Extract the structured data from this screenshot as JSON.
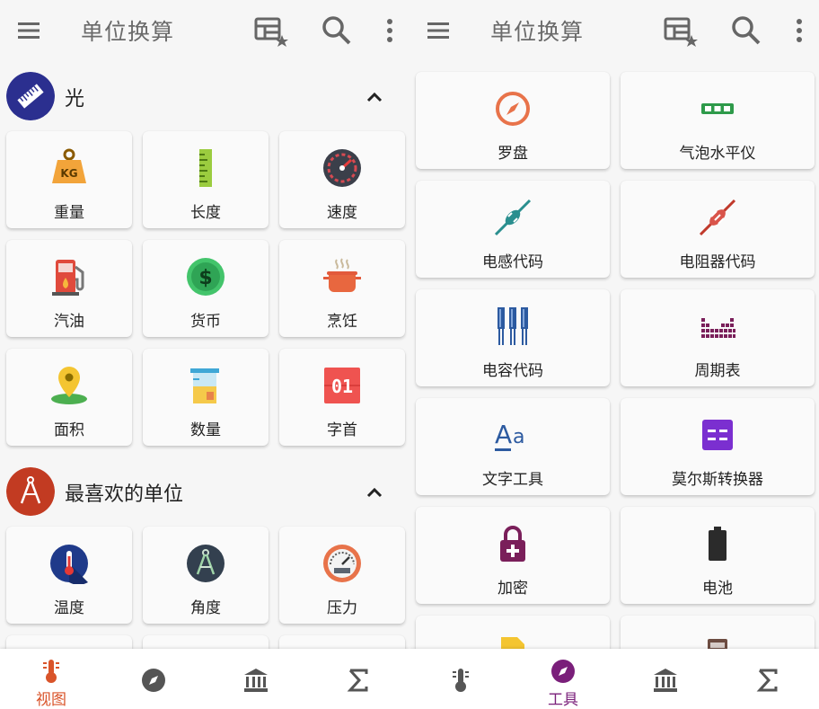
{
  "left": {
    "appbar": {
      "title": "单位换算"
    },
    "section_light": {
      "title": "光"
    },
    "light_tiles": [
      {
        "label": "重量",
        "icon": "weight-icon"
      },
      {
        "label": "长度",
        "icon": "ruler-icon"
      },
      {
        "label": "速度",
        "icon": "speedometer-icon"
      },
      {
        "label": "汽油",
        "icon": "fuel-pump-icon"
      },
      {
        "label": "货币",
        "icon": "currency-icon"
      },
      {
        "label": "烹饪",
        "icon": "cooking-pot-icon"
      },
      {
        "label": "面积",
        "icon": "map-pin-icon"
      },
      {
        "label": "数量",
        "icon": "beaker-icon"
      },
      {
        "label": "字首",
        "icon": "prefix-icon"
      }
    ],
    "section_fav": {
      "title": "最喜欢的单位"
    },
    "fav_tiles": [
      {
        "label": "温度",
        "icon": "thermometer-icon"
      },
      {
        "label": "角度",
        "icon": "compass-drafting-icon"
      },
      {
        "label": "压力",
        "icon": "pressure-gauge-icon"
      }
    ],
    "bottom_nav": [
      {
        "label": "视图",
        "icon": "thermometer-nav-icon",
        "active": true
      },
      {
        "label": "",
        "icon": "compass-nav-icon",
        "active": false
      },
      {
        "label": "",
        "icon": "bank-nav-icon",
        "active": false
      },
      {
        "label": "",
        "icon": "sigma-nav-icon",
        "active": false
      }
    ]
  },
  "right": {
    "appbar": {
      "title": "单位换算"
    },
    "tool_tiles": [
      {
        "label": "罗盘",
        "icon": "compass-icon"
      },
      {
        "label": "气泡水平仪",
        "icon": "bubble-level-icon"
      },
      {
        "label": "电感代码",
        "icon": "inductor-icon"
      },
      {
        "label": "电阻器代码",
        "icon": "resistor-icon"
      },
      {
        "label": "电容代码",
        "icon": "capacitor-icon"
      },
      {
        "label": "周期表",
        "icon": "periodic-table-icon"
      },
      {
        "label": "文字工具",
        "icon": "text-tool-icon"
      },
      {
        "label": "莫尔斯转换器",
        "icon": "morse-icon"
      },
      {
        "label": "加密",
        "icon": "lock-icon"
      },
      {
        "label": "电池",
        "icon": "battery-icon"
      }
    ],
    "bottom_nav": [
      {
        "label": "",
        "icon": "thermometer-nav-icon",
        "active": false
      },
      {
        "label": "工具",
        "icon": "compass-nav-icon",
        "active": true
      },
      {
        "label": "",
        "icon": "bank-nav-icon",
        "active": false
      },
      {
        "label": "",
        "icon": "sigma-nav-icon",
        "active": false
      }
    ]
  },
  "colors": {
    "accent": "#d9542a",
    "nav_active_purple": "#7a1f7a",
    "light_badge": "#2b2f8f",
    "fav_badge": "#c23b22"
  }
}
